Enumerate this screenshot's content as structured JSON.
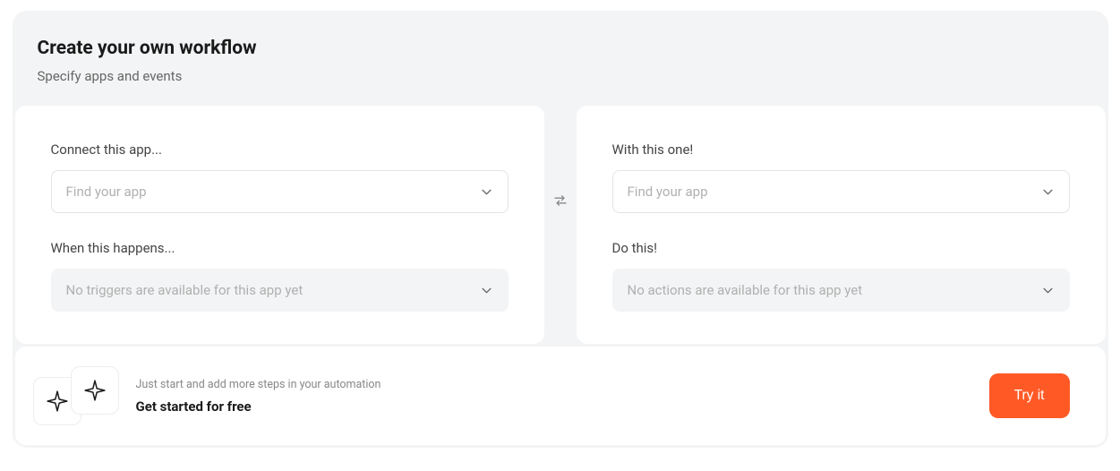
{
  "header": {
    "title": "Create your own workflow",
    "subtitle": "Specify apps and events"
  },
  "left": {
    "connect_label": "Connect this app...",
    "app_placeholder": "Find your app",
    "trigger_label": "When this happens...",
    "trigger_placeholder": "No triggers are available for this app yet"
  },
  "right": {
    "connect_label": "With this one!",
    "app_placeholder": "Find your app",
    "action_label": "Do this!",
    "action_placeholder": "No actions are available for this app yet"
  },
  "footer": {
    "hint": "Just start and add more steps in your automation",
    "headline": "Get started for free",
    "try_label": "Try it"
  }
}
